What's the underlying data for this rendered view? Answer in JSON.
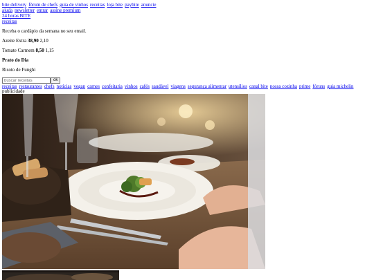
{
  "topnav": [
    "bite delivery",
    "fórum de chefs",
    "guia de vinhos",
    "receitas",
    "loja bite",
    "paybite",
    "anuncie"
  ],
  "subnav": [
    "ajuda",
    "newsletter",
    "entrar",
    "assine premium"
  ],
  "news_link": "24 horas BITE",
  "recipes_link": "receitas",
  "newsletter_text": "Receba o cardápio da semana no seu email.",
  "quotes": [
    {
      "name": "Azeite Extra",
      "price": "38,90",
      "change": "2,10"
    },
    {
      "name": "Tomate Carmem",
      "price": "8,50",
      "change": "1,15"
    }
  ],
  "dish_of_day": {
    "title": "Prato do Dia",
    "name": "Risoto de Funghi"
  },
  "search": {
    "placeholder": "buscar receitas",
    "button": "ok"
  },
  "categories": [
    "receitas",
    "restaurantes",
    "chefs",
    "notícias",
    "vegan",
    "carnes",
    "confeitaria",
    "vinhos",
    "cafés",
    "saudável",
    "viagens",
    "segurança alimentar",
    "utensílios",
    "canal bite",
    "nossa cozinha",
    "prime",
    "fóruns",
    "guia michelin"
  ],
  "ad_label": "publicidade",
  "colors": {
    "link": "#0000ee",
    "text": "#000000",
    "background": "#ffffff"
  }
}
